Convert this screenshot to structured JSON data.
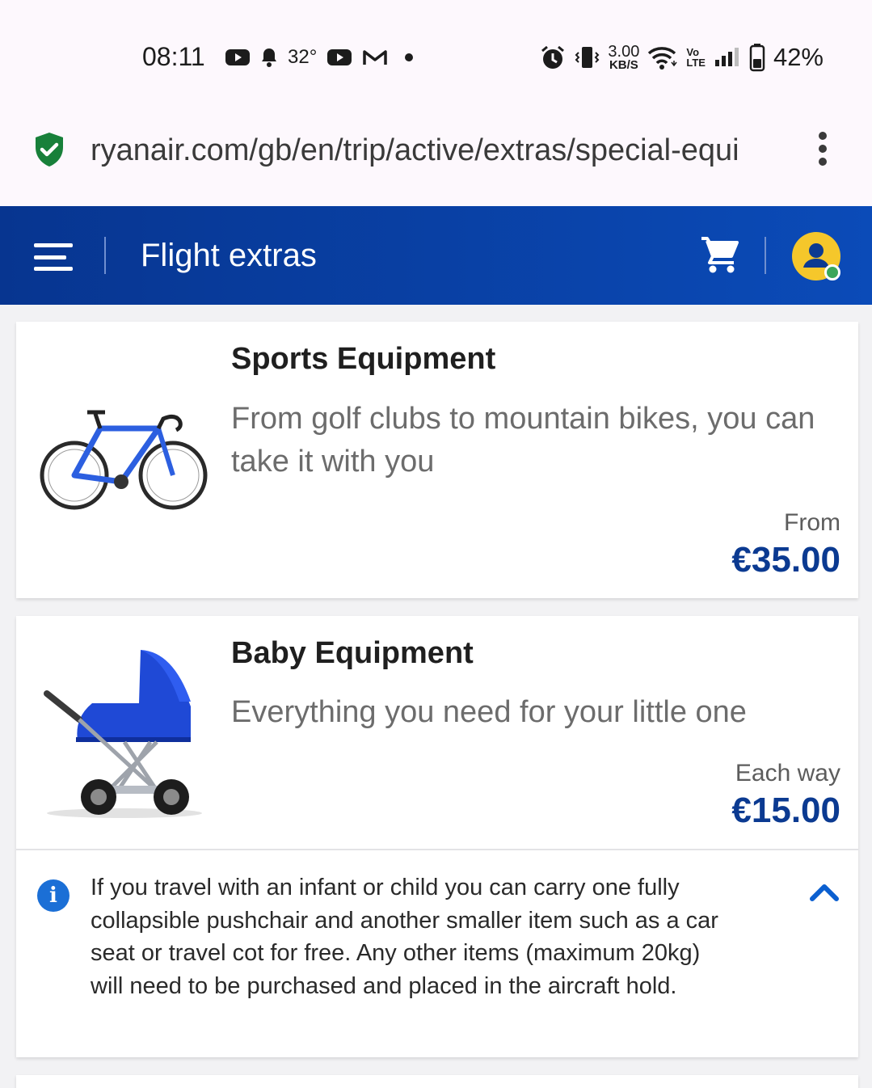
{
  "status_bar": {
    "time": "08:11",
    "temperature": "32°",
    "net_speed_value": "3.00",
    "net_speed_unit": "KB/S",
    "volte": "Vo\nLTE",
    "battery": "42%",
    "icons": [
      "youtube-icon",
      "notification-bell-icon",
      "youtube-icon",
      "gmail-icon",
      "dot-icon",
      "alarm-icon",
      "vibrate-icon",
      "wifi-icon",
      "signal-icon",
      "battery-icon"
    ]
  },
  "browser": {
    "url": "ryanair.com/gb/en/trip/active/extras/special-equi",
    "secure_icon": "shield-check-icon",
    "menu_icon": "kebab-menu-icon"
  },
  "header": {
    "title": "Flight extras",
    "menu_icon": "hamburger-icon",
    "cart_icon": "cart-icon",
    "account_icon": "user-avatar-icon",
    "colors": {
      "header_from": "#073590",
      "header_to": "#0b4bb8",
      "avatar": "#f5c72b",
      "online_dot": "#3aa65a"
    }
  },
  "cards": [
    {
      "title": "Sports Equipment",
      "description": "From golf clubs to mountain bikes, you can take it with you",
      "price_label": "From",
      "price": "€35.00",
      "image": "bicycle-image"
    },
    {
      "title": "Baby Equipment",
      "description": "Everything you need for your little one",
      "price_label": "Each way",
      "price": "€15.00",
      "image": "pram-image",
      "info": {
        "icon": "info-icon",
        "text": "If you travel with an infant or child you can carry one fully collapsible pushchair and another smaller item such as a car seat or travel cot for free. Any other items (maximum 20kg) will need to be purchased and placed in the aircraft hold.",
        "toggle_icon": "chevron-up-icon"
      }
    }
  ],
  "colors": {
    "price": "#0b3a91",
    "info_icon": "#1b6fd6"
  }
}
